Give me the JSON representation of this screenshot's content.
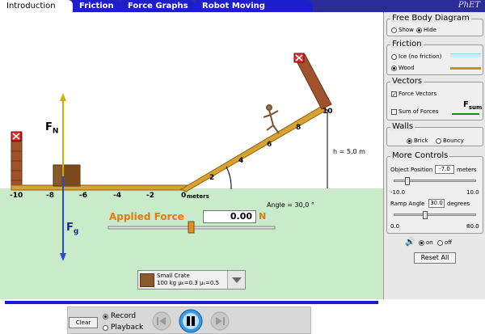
{
  "tabs": [
    "Introduction",
    "Friction",
    "Force Graphs",
    "Robot Moving Company"
  ],
  "logo": "PhET",
  "scene": {
    "axis_ticks": [
      "-10",
      "-8",
      "-6",
      "-4",
      "-2",
      "0"
    ],
    "axis_unit": "meters",
    "ramp_ticks": [
      "2",
      "4",
      "6",
      "8",
      "10"
    ],
    "force_normal_label": "F",
    "force_normal_sub": "N",
    "force_gravity_label": "F",
    "force_gravity_sub": "g",
    "applied_force_label": "Applied Force",
    "applied_force_value": "0.00",
    "applied_force_unit": "N",
    "angle_label": "Angle = 30,0 °",
    "height_label": "h = 5,0 m",
    "object": {
      "name": "Small Crate",
      "props": "100 kg μₖ=0.3 μₛ=0.5"
    }
  },
  "panel": {
    "fbd": {
      "title": "Free Body Diagram",
      "show": "Show",
      "hide": "Hide"
    },
    "friction": {
      "title": "Friction",
      "ice": "Ice (no friction)",
      "wood": "Wood"
    },
    "vectors": {
      "title": "Vectors",
      "force_vectors": "Force Vectors",
      "sum_of_forces": "Sum of Forces",
      "fsum_label": "F",
      "fsum_sub": "sum"
    },
    "walls": {
      "title": "Walls",
      "brick": "Brick",
      "bouncy": "Bouncy"
    },
    "more": {
      "title": "More Controls",
      "object_position_label": "Object Position",
      "object_position_value": "-7.0",
      "object_position_unit": "meters",
      "pos_min": "-10.0",
      "pos_max": "10.0",
      "ramp_angle_label": "Ramp Angle",
      "ramp_angle_value": "30.0",
      "ramp_angle_unit": "degrees",
      "angle_min": "0.0",
      "angle_max": "80.0"
    },
    "sound": {
      "on": "on",
      "off": "off"
    },
    "reset": "Reset All"
  },
  "bottom": {
    "clear": "Clear",
    "record": "Record",
    "playback": "Playback"
  },
  "colors": {
    "tab_bar": "#2b2b9a",
    "sky": "#ffffff",
    "ground": "#c9ebc9",
    "ramp": "#d9a033",
    "applied_force": "#e07a10",
    "timeline": "#1a1ad0"
  }
}
